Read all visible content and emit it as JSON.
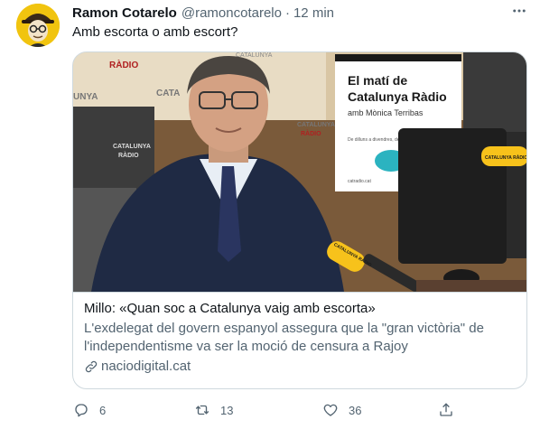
{
  "author": {
    "display_name": "Ramon Cotarelo",
    "handle": "@ramoncotarelo",
    "separator": "·",
    "time": "12 min"
  },
  "tweet": {
    "text": "Amb escorta o amb escort?"
  },
  "card": {
    "title": "Millo: «Quan soc a Catalunya vaig amb escorta»",
    "description": "L'exdelegat del govern espanyol assegura que la \"gran victòria\" de l'independentisme va ser la moció de censura a Rajoy",
    "domain": "naciodigital.cat",
    "image": {
      "poster_line1": "El matí de",
      "poster_line2": "Catalunya Ràdio",
      "poster_line3": "amb Mònica Terribas",
      "poster_line4": "De dilluns a divendres, de 6 a 13 h",
      "poster_site": "catradio.cat",
      "brand_label": "RÀDIO",
      "brand_label_2": "CATALUNYA",
      "brand_label_3": "CATA",
      "brand_label_4": "UNYA",
      "mic_label": "CATALUNYA RÀDIO",
      "logo_label_1": "CATALUNYA",
      "logo_label_2": "RÀDIO"
    }
  },
  "actions": {
    "reply_count": "6",
    "retweet_count": "13",
    "like_count": "36"
  },
  "colors": {
    "text_primary": "#0f1419",
    "text_secondary": "#536471",
    "border": "#cfd9de",
    "avatar_bg": "#f1c40f",
    "mic_yellow": "#f7c21b",
    "poster_teal": "#2bb3c0"
  },
  "icons": {
    "more": "more-options-icon",
    "reply": "reply-icon",
    "retweet": "retweet-icon",
    "like": "heart-icon",
    "share": "share-icon",
    "link": "link-icon"
  }
}
